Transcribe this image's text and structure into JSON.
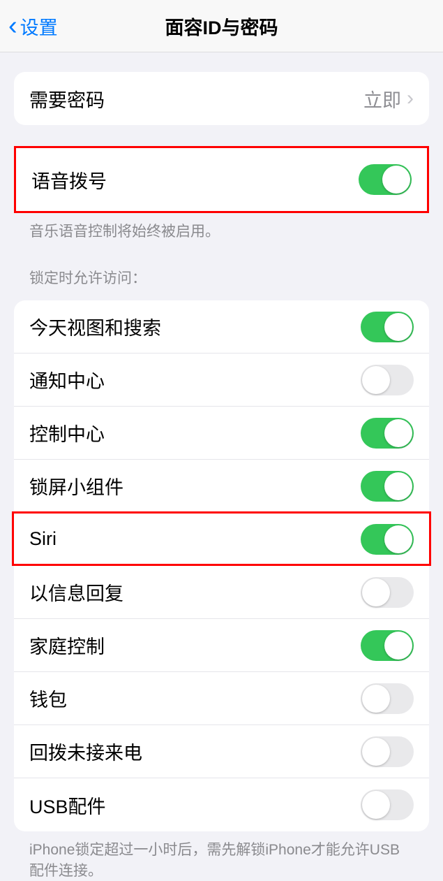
{
  "header": {
    "back_label": "设置",
    "title": "面容ID与密码"
  },
  "passcode": {
    "label": "需要密码",
    "value": "立即"
  },
  "voice_dial": {
    "label": "语音拨号",
    "on": true,
    "footer": "音乐语音控制将始终被启用。"
  },
  "lock_access": {
    "header": "锁定时允许访问：",
    "items": [
      {
        "label": "今天视图和搜索",
        "on": true
      },
      {
        "label": "通知中心",
        "on": false
      },
      {
        "label": "控制中心",
        "on": true
      },
      {
        "label": "锁屏小组件",
        "on": true
      },
      {
        "label": "Siri",
        "on": true,
        "highlighted": true
      },
      {
        "label": "以信息回复",
        "on": false
      },
      {
        "label": "家庭控制",
        "on": true
      },
      {
        "label": "钱包",
        "on": false
      },
      {
        "label": "回拨未接来电",
        "on": false
      },
      {
        "label": "USB配件",
        "on": false
      }
    ],
    "footer": "iPhone锁定超过一小时后，需先解锁iPhone才能允许USB配件连接。"
  }
}
